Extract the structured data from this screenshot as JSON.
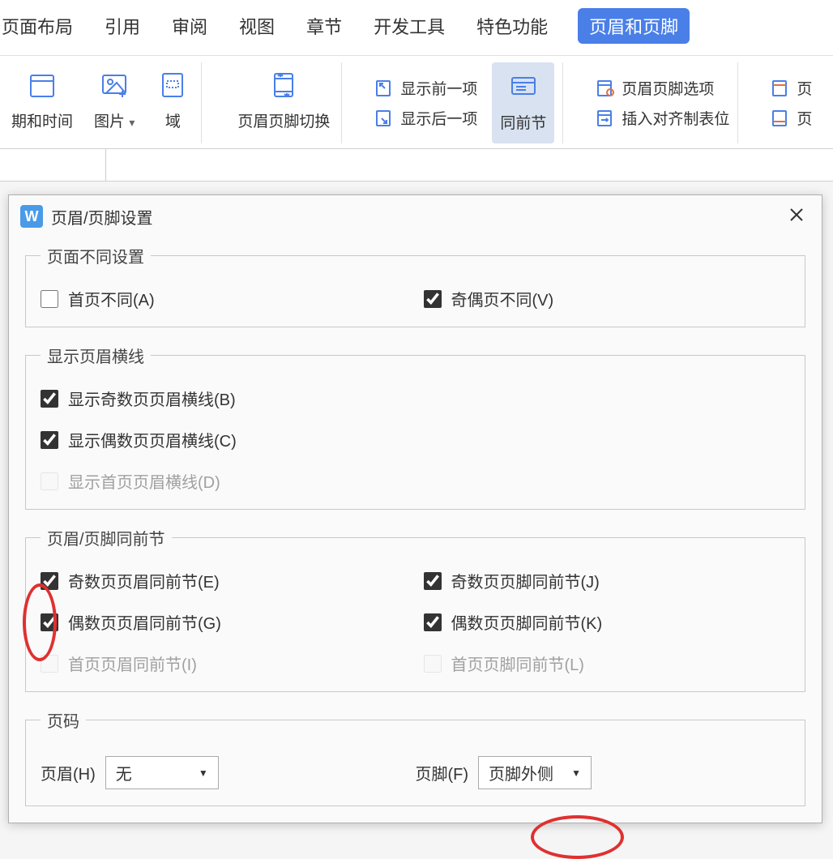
{
  "menu": {
    "tabs": [
      "页面布局",
      "引用",
      "审阅",
      "视图",
      "章节",
      "开发工具",
      "特色功能"
    ],
    "active": "页眉和页脚"
  },
  "toolbar": {
    "date_time": "期和时间",
    "picture": "图片",
    "field": "域",
    "switch": "页眉页脚切换",
    "show_prev": "显示前一项",
    "show_next": "显示后一项",
    "same_prev": "同前节",
    "options": "页眉页脚选项",
    "insert_tab": "插入对齐制表位",
    "cut_off_1": "页",
    "cut_off_2": "页"
  },
  "dialog": {
    "title": "页眉/页脚设置",
    "groups": {
      "page_diff": {
        "legend": "页面不同设置",
        "first_diff": "首页不同(A)",
        "odd_even_diff": "奇偶页不同(V)"
      },
      "header_line": {
        "legend": "显示页眉横线",
        "odd": "显示奇数页页眉横线(B)",
        "even": "显示偶数页页眉横线(C)",
        "first": "显示首页页眉横线(D)"
      },
      "same_prev": {
        "legend": "页眉/页脚同前节",
        "odd_header": "奇数页页眉同前节(E)",
        "even_header": "偶数页页眉同前节(G)",
        "first_header": "首页页眉同前节(I)",
        "odd_footer": "奇数页页脚同前节(J)",
        "even_footer": "偶数页页脚同前节(K)",
        "first_footer": "首页页脚同前节(L)"
      },
      "page_num": {
        "legend": "页码",
        "header_label": "页眉(H)",
        "header_value": "无",
        "footer_label": "页脚(F)",
        "footer_value": "页脚外侧"
      }
    }
  }
}
